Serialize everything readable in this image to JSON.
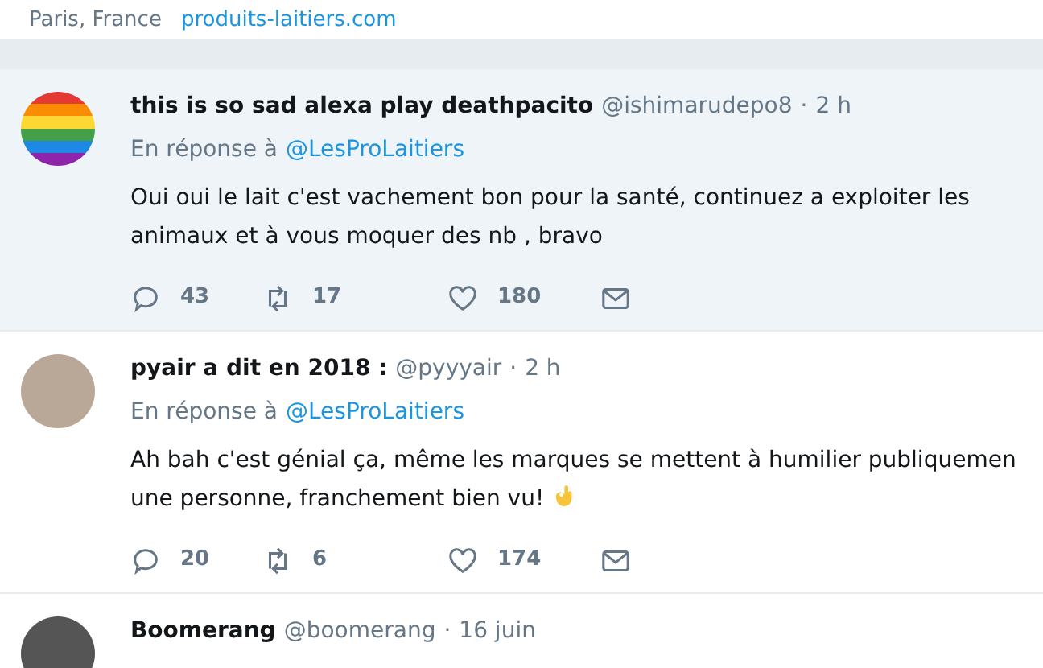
{
  "profile_footer": {
    "location": "Paris, France",
    "website": "produits-laitiers.com"
  },
  "tweets": [
    {
      "kind": "rainbow",
      "display_name": "this is so sad alexa play deathpacito",
      "handle": "@ishimarudepo8",
      "separator": "·",
      "time": "2 h",
      "reply_prefix": "En réponse à",
      "reply_to": "@LesProLaitiers",
      "highlighted": true,
      "text_lines": [
        "Oui oui le lait c'est vachement bon pour la santé, continuez a exploiter les",
        "animaux et à vous moquer des nb , bravo"
      ],
      "replies": "43",
      "retweets": "17",
      "likes": "180"
    },
    {
      "kind": "photo",
      "display_name": "pyair a dit en 2018 :",
      "handle": "@pyyyair",
      "separator": "·",
      "time": "2 h",
      "reply_prefix": "En réponse à",
      "reply_to": "@LesProLaitiers",
      "highlighted": false,
      "text_lines": [
        "Ah bah c'est génial ça, même les marques se mettent à humilier publiquemen",
        "une personne, franchement bien vu!"
      ],
      "emoji": true,
      "replies": "20",
      "retweets": "6",
      "likes": "174"
    },
    {
      "kind": "dark",
      "display_name": "Boomerang",
      "handle": "@boomerang",
      "separator": "·",
      "time": "16 juin"
    }
  ]
}
